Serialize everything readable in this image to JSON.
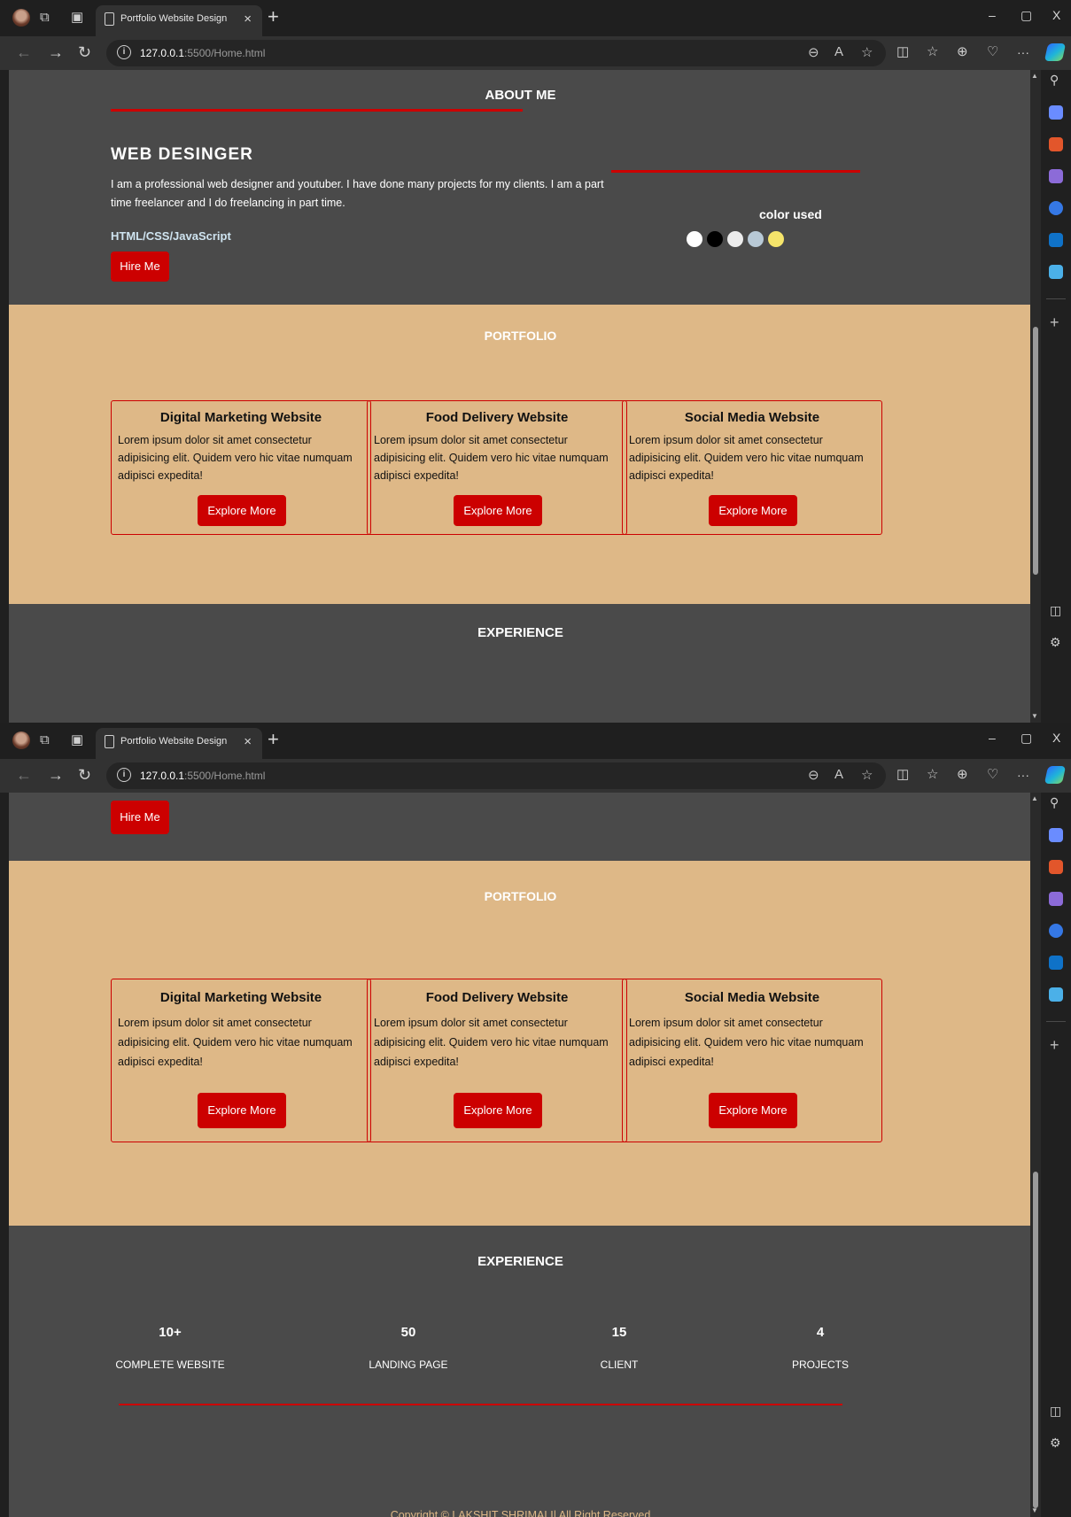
{
  "browser": {
    "tab_title": "Portfolio Website Design",
    "tab_close": "×",
    "new_tab": "+",
    "url_host": "127.0.0.1",
    "url_rest": ":5500/Home.html",
    "minimize": "–",
    "restore": "▢",
    "close": "X",
    "more": "···"
  },
  "about": {
    "heading": "ABOUT ME",
    "title": "WEB DESINGER",
    "description": "I am a professional web designer and youtuber. I have done many projects for my clients. I am a part time freelancer and I do freelancing in part time.",
    "skills": "HTML/CSS/JavaScript",
    "hire_button": "Hire Me",
    "color_label": "color used",
    "colors": [
      "#ffffff",
      "#000000",
      "#ececec",
      "#b8c9d6",
      "#f6e56b"
    ]
  },
  "portfolio": {
    "heading": "PORTFOLIO",
    "cards": [
      {
        "title": "Digital Marketing Website",
        "text": "Lorem ipsum dolor sit amet consectetur adipisicing elit. Quidem vero hic vitae numquam adipisci expedita!",
        "button": "Explore More"
      },
      {
        "title": "Food Delivery Website",
        "text": "Lorem ipsum dolor sit amet consectetur adipisicing elit. Quidem vero hic vitae numquam adipisci expedita!",
        "button": "Explore More"
      },
      {
        "title": "Social Media Website",
        "text": "Lorem ipsum dolor sit amet consectetur adipisicing elit. Quidem vero hic vitae numquam adipisci expedita!",
        "button": "Explore More"
      }
    ]
  },
  "experience": {
    "heading": "EXPERIENCE",
    "stats": [
      {
        "value": "10+",
        "label": "COMPLETE WEBSITE"
      },
      {
        "value": "50",
        "label": "LANDING PAGE"
      },
      {
        "value": "15",
        "label": "CLIENT"
      },
      {
        "value": "4",
        "label": "PROJECTS"
      }
    ]
  },
  "footer": {
    "copyright": "Copyright © LAKSHIT SHRIMALI| All Right Reserved"
  },
  "theme": {
    "dark_bg": "#4a4a4a",
    "tan_bg": "#deb887",
    "accent_red": "#cc0000"
  }
}
